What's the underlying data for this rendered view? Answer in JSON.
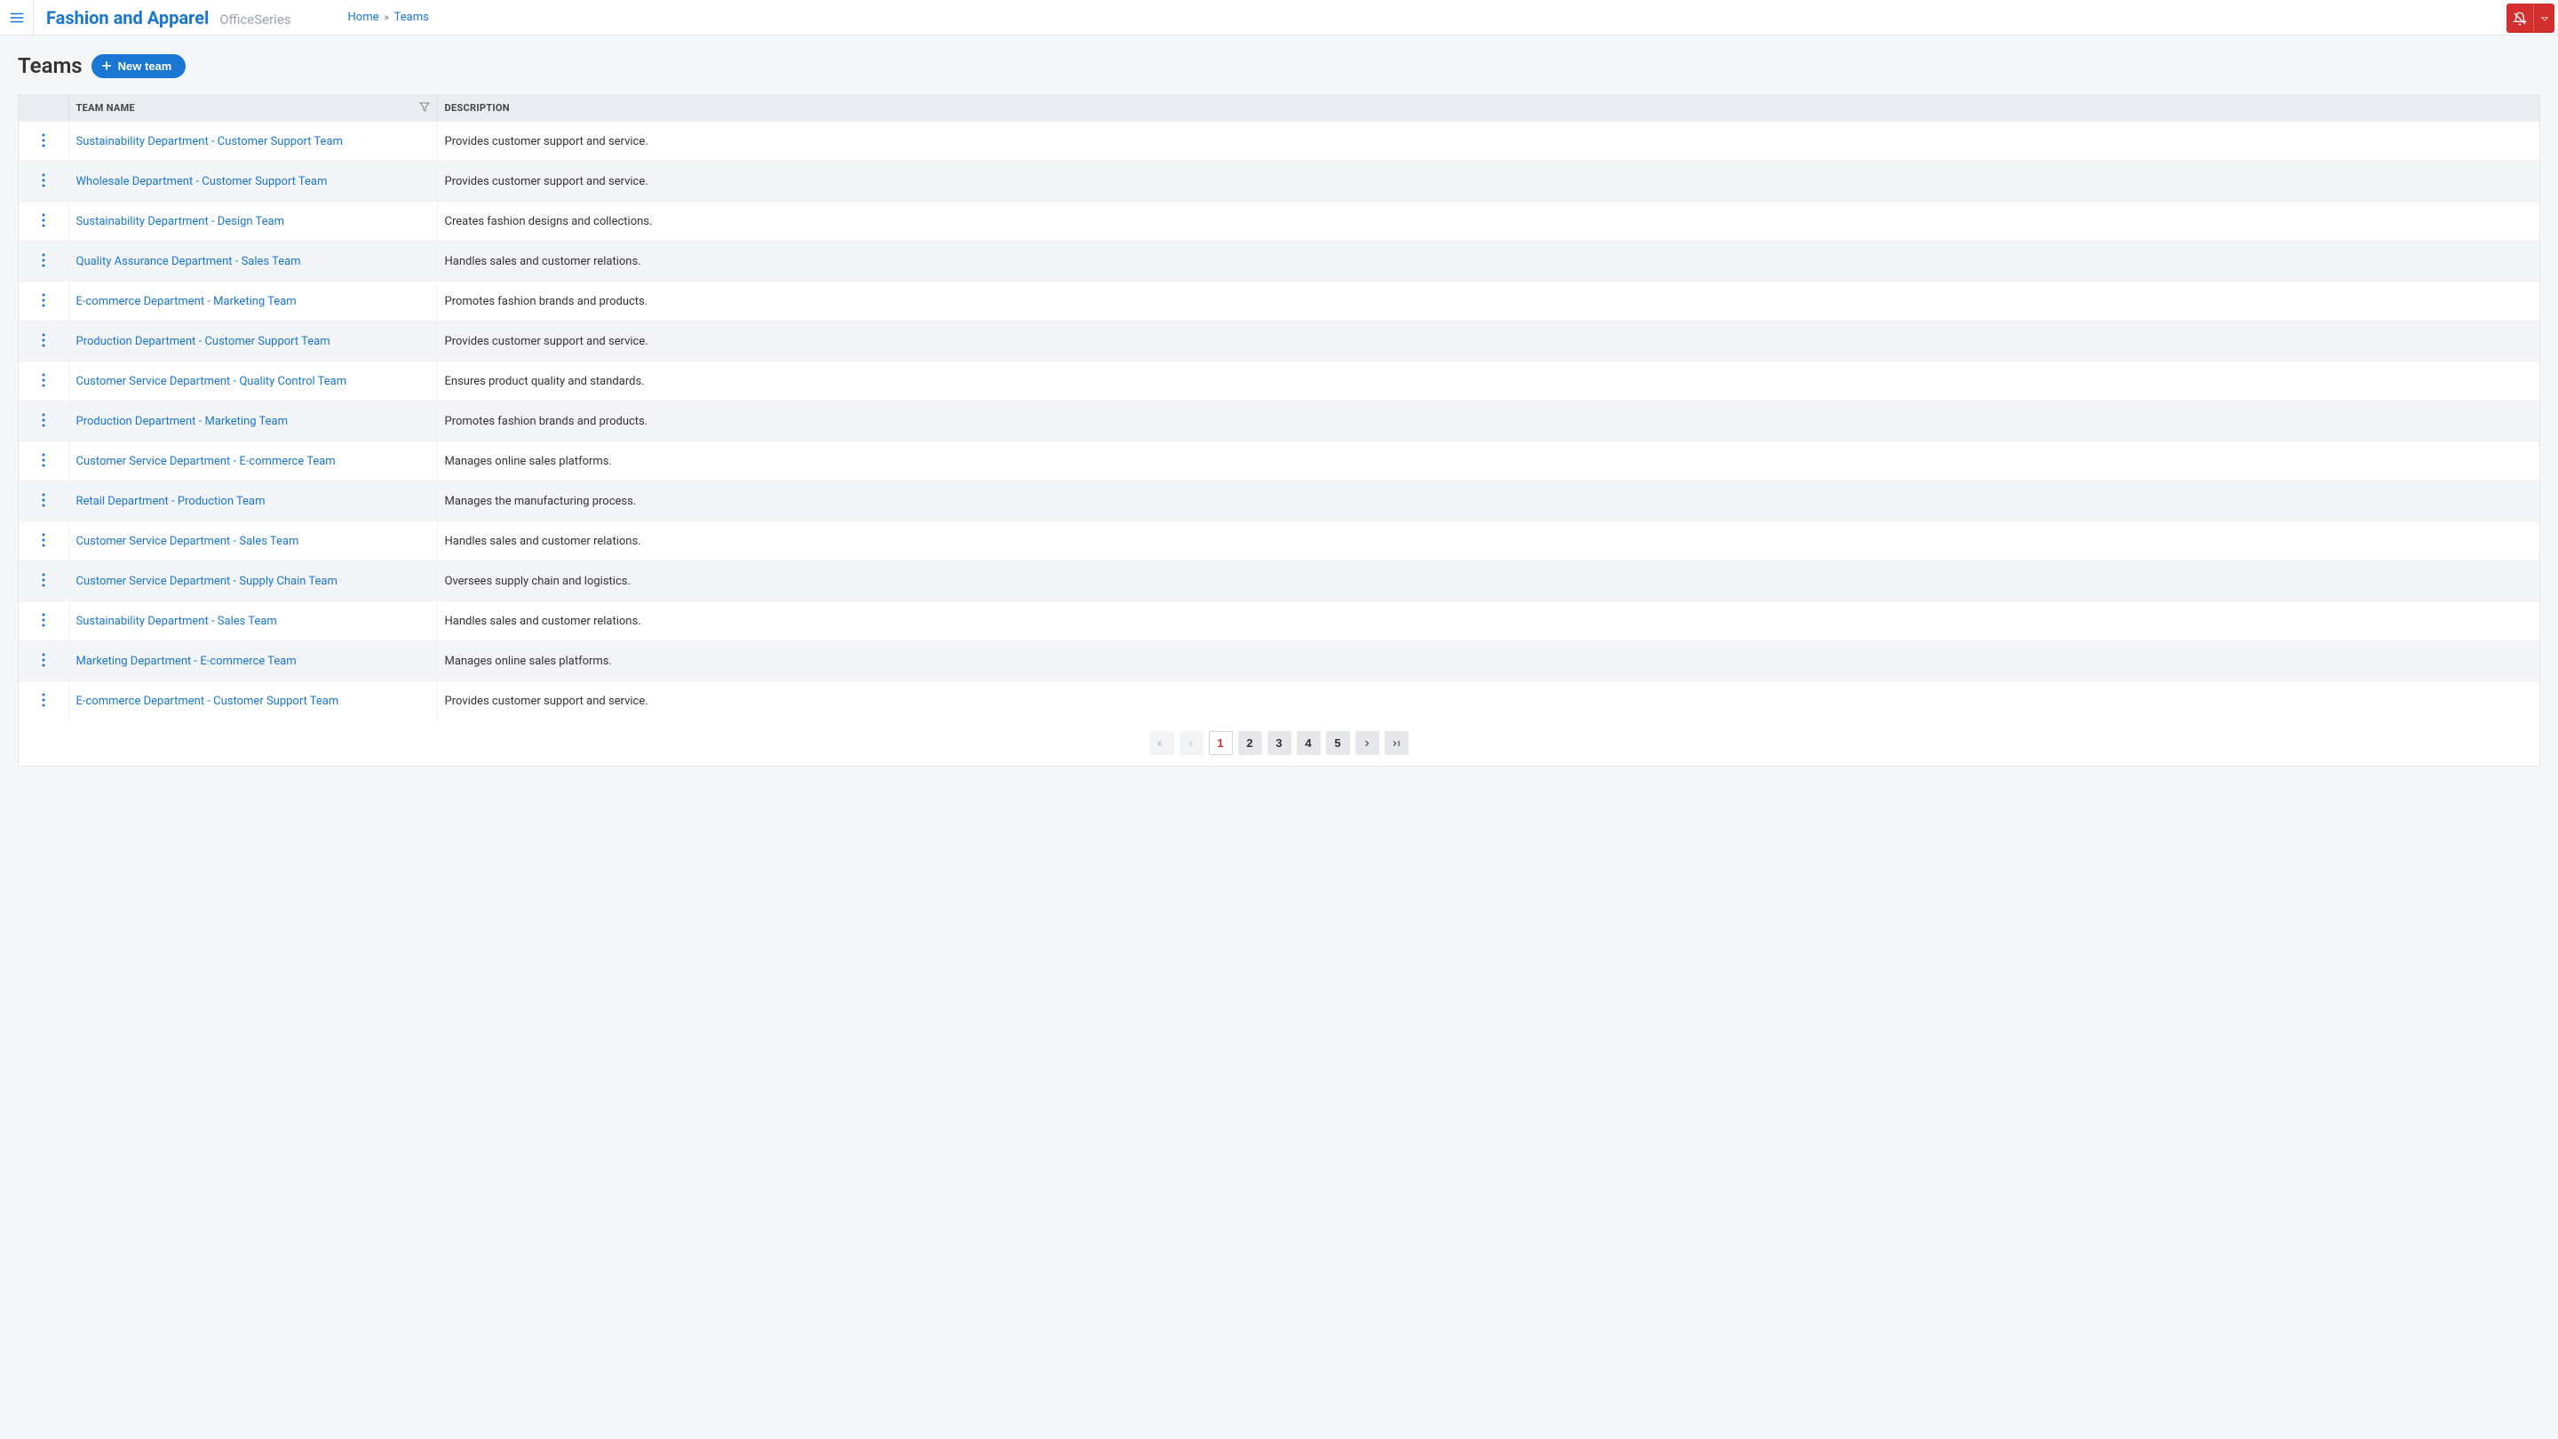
{
  "header": {
    "brand_title": "Fashion and Apparel",
    "brand_sub": "OfficeSeries"
  },
  "breadcrumb": {
    "home": "Home",
    "current": "Teams"
  },
  "page": {
    "title": "Teams",
    "new_button": "New team"
  },
  "table": {
    "columns": {
      "name": "Team Name",
      "description": "Description"
    },
    "rows": [
      {
        "name": "Sustainability Department - Customer Support Team",
        "description": "Provides customer support and service."
      },
      {
        "name": "Wholesale Department - Customer Support Team",
        "description": "Provides customer support and service."
      },
      {
        "name": "Sustainability Department - Design Team",
        "description": "Creates fashion designs and collections."
      },
      {
        "name": "Quality Assurance Department - Sales Team",
        "description": "Handles sales and customer relations."
      },
      {
        "name": "E-commerce Department - Marketing Team",
        "description": "Promotes fashion brands and products."
      },
      {
        "name": "Production Department - Customer Support Team",
        "description": "Provides customer support and service."
      },
      {
        "name": "Customer Service Department - Quality Control Team",
        "description": "Ensures product quality and standards."
      },
      {
        "name": "Production Department - Marketing Team",
        "description": "Promotes fashion brands and products."
      },
      {
        "name": "Customer Service Department - E-commerce Team",
        "description": "Manages online sales platforms."
      },
      {
        "name": "Retail Department - Production Team",
        "description": "Manages the manufacturing process."
      },
      {
        "name": "Customer Service Department - Sales Team",
        "description": "Handles sales and customer relations."
      },
      {
        "name": "Customer Service Department - Supply Chain Team",
        "description": "Oversees supply chain and logistics."
      },
      {
        "name": "Sustainability Department - Sales Team",
        "description": "Handles sales and customer relations."
      },
      {
        "name": "Marketing Department - E-commerce Team",
        "description": "Manages online sales platforms."
      },
      {
        "name": "E-commerce Department - Customer Support Team",
        "description": "Provides customer support and service."
      }
    ]
  },
  "pagination": {
    "pages": [
      "1",
      "2",
      "3",
      "4",
      "5"
    ],
    "current": "1"
  }
}
